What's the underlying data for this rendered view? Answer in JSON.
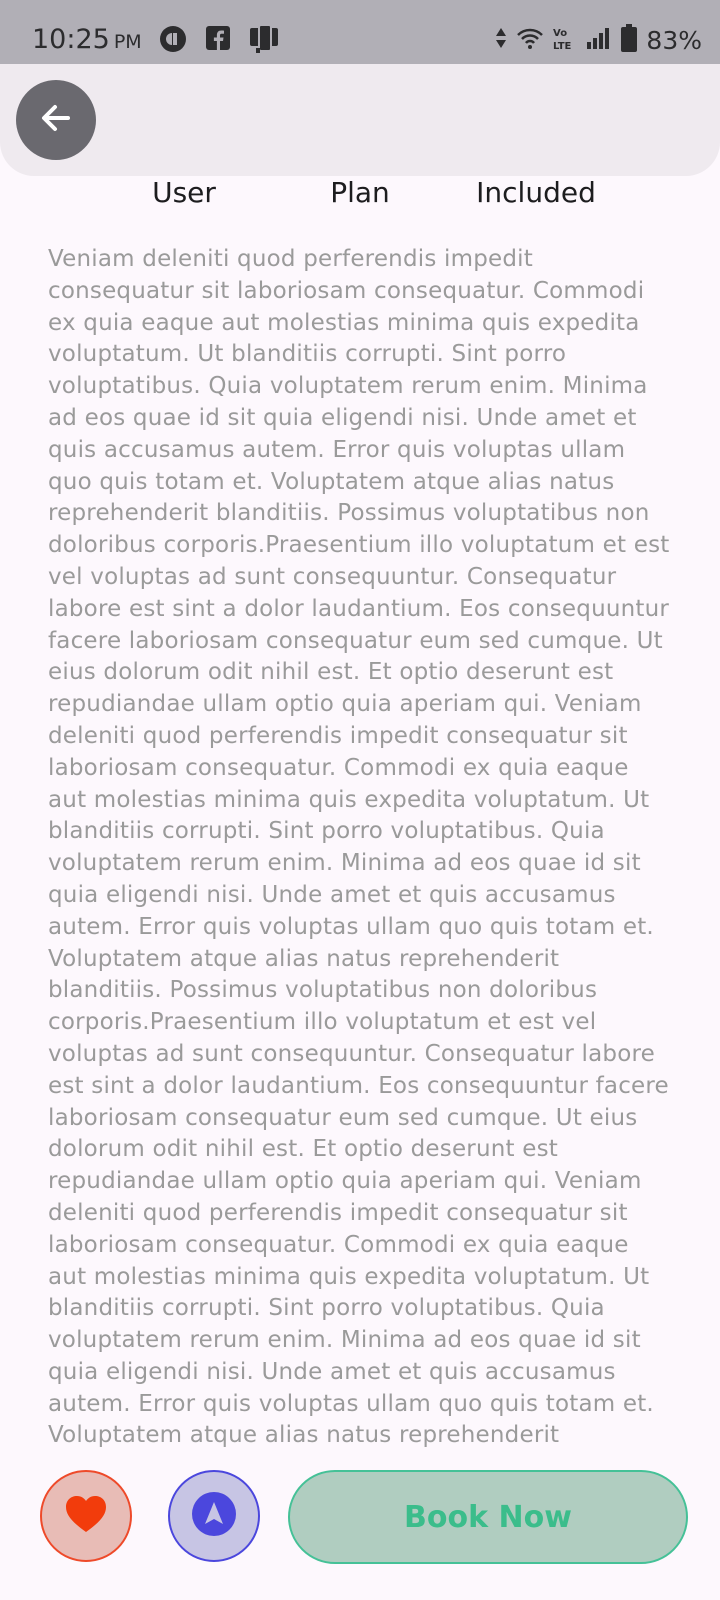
{
  "status_bar": {
    "time": "10:25",
    "period": "PM",
    "battery": "83%",
    "icons_left": [
      "sync-icon",
      "facebook-icon",
      "app-icon"
    ],
    "icons_right": [
      "data-arrows-icon",
      "wifi-icon",
      "volte-icon",
      "signal-icon",
      "battery-icon"
    ]
  },
  "header": {
    "back_icon": "arrow-left-icon",
    "tabs": [
      {
        "label": "User"
      },
      {
        "label": "Plan"
      },
      {
        "label": "Included"
      }
    ]
  },
  "content": {
    "paragraph": "Veniam deleniti quod perferendis impedit consequatur sit laboriosam consequatur. Commodi ex quia eaque aut molestias minima quis expedita voluptatum. Ut blanditiis corrupti. Sint porro voluptatibus. Quia voluptatem rerum enim. Minima ad eos quae id sit quia eligendi nisi. Unde amet et quis accusamus autem. Error quis voluptas ullam quo quis totam et. Voluptatem atque alias natus reprehenderit blanditiis. Possimus voluptatibus non doloribus corporis.Praesentium illo voluptatum et est vel voluptas ad sunt consequuntur. Consequatur labore est sint a dolor laudantium. Eos consequuntur facere laboriosam consequatur eum sed cumque. Ut eius dolorum odit nihil est. Et optio deserunt est repudiandae ullam optio quia aperiam qui. Veniam deleniti quod perferendis impedit consequatur sit laboriosam consequatur. Commodi ex quia eaque aut molestias minima quis expedita voluptatum. Ut blanditiis corrupti. Sint porro voluptatibus. Quia voluptatem rerum enim. Minima ad eos quae id sit quia eligendi nisi. Unde amet et quis accusamus autem. Error quis voluptas ullam quo quis totam et. Voluptatem atque alias natus reprehenderit blanditiis. Possimus voluptatibus non doloribus corporis.Praesentium illo voluptatum et est vel voluptas ad sunt consequuntur. Consequatur labore est sint a dolor laudantium. Eos consequuntur facere laboriosam consequatur eum sed cumque. Ut eius dolorum odit nihil est. Et optio deserunt est repudiandae ullam optio quia aperiam qui. Veniam deleniti quod perferendis impedit consequatur sit laboriosam consequatur. Commodi ex quia eaque aut molestias minima quis expedita voluptatum. Ut blanditiis corrupti. Sint porro voluptatibus. Quia voluptatem rerum enim. Minima ad eos quae id sit quia eligendi nisi. Unde amet et quis accusamus autem. Error quis voluptas ullam quo quis totam et. Voluptatem atque alias natus reprehenderit"
  },
  "actions": {
    "favorite_icon": "heart-icon",
    "navigate_icon": "navigation-arrow-icon",
    "book_label": "Book Now"
  },
  "colors": {
    "accent_green": "#3bbd8b",
    "favorite_red": "#ee4a2a",
    "navigate_blue": "#4b47dd"
  }
}
